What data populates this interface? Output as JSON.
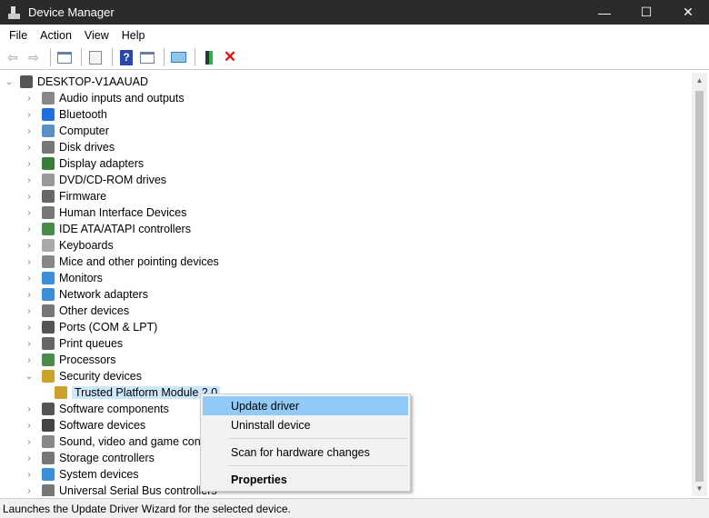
{
  "window": {
    "title": "Device Manager",
    "minimize": "—",
    "maximize": "☐",
    "close": "✕"
  },
  "menu": [
    "File",
    "Action",
    "View",
    "Help"
  ],
  "toolbar": {
    "icons": [
      "back-icon",
      "forward-icon",
      "show-hide-console-tree-icon",
      "properties-icon",
      "help-icon",
      "action-pane-icon",
      "scan-hardware-icon",
      "update-driver-icon",
      "uninstall-icon"
    ]
  },
  "tree": {
    "root": "DESKTOP-V1AAUAD",
    "items": [
      {
        "label": "Audio inputs and outputs",
        "color": "#888"
      },
      {
        "label": "Bluetooth",
        "color": "#1e6fd9"
      },
      {
        "label": "Computer",
        "color": "#5b8fc7"
      },
      {
        "label": "Disk drives",
        "color": "#777"
      },
      {
        "label": "Display adapters",
        "color": "#3a7d3a"
      },
      {
        "label": "DVD/CD-ROM drives",
        "color": "#999"
      },
      {
        "label": "Firmware",
        "color": "#666"
      },
      {
        "label": "Human Interface Devices",
        "color": "#777"
      },
      {
        "label": "IDE ATA/ATAPI controllers",
        "color": "#4a8a4a"
      },
      {
        "label": "Keyboards",
        "color": "#aaa"
      },
      {
        "label": "Mice and other pointing devices",
        "color": "#888"
      },
      {
        "label": "Monitors",
        "color": "#3b8ed8"
      },
      {
        "label": "Network adapters",
        "color": "#3b8ed8"
      },
      {
        "label": "Other devices",
        "color": "#777"
      },
      {
        "label": "Ports (COM & LPT)",
        "color": "#555"
      },
      {
        "label": "Print queues",
        "color": "#666"
      },
      {
        "label": "Processors",
        "color": "#4a8a4a"
      },
      {
        "label": "Security devices",
        "color": "#c9a227",
        "expanded": true,
        "children": [
          "Trusted Platform Module 2.0"
        ]
      },
      {
        "label": "Software components",
        "color": "#555"
      },
      {
        "label": "Software devices",
        "color": "#444"
      },
      {
        "label": "Sound, video and game controllers",
        "color": "#888"
      },
      {
        "label": "Storage controllers",
        "color": "#777"
      },
      {
        "label": "System devices",
        "color": "#3b8ed8"
      },
      {
        "label": "Universal Serial Bus controllers",
        "color": "#777"
      }
    ]
  },
  "context_menu": {
    "update": "Update driver",
    "uninstall": "Uninstall device",
    "scan": "Scan for hardware changes",
    "properties": "Properties"
  },
  "status": "Launches the Update Driver Wizard for the selected device."
}
